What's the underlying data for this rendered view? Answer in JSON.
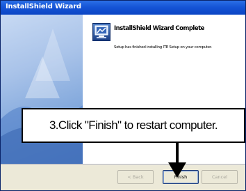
{
  "window": {
    "title": "InstallShield Wizard"
  },
  "dialog": {
    "heading": "InstallShield Wizard Complete",
    "message": "Setup has finished installing ITE Setup on your computer."
  },
  "buttons": {
    "back": "< Back",
    "finish": "Finish",
    "cancel": "Cancel"
  },
  "callout": {
    "text": "3.Click \"Finish\" to restart computer."
  },
  "colors": {
    "titlebar": "#1654d6",
    "dialog_bg": "#ece9d8",
    "side_panel": "#a9c3e9",
    "callout_border": "#000000"
  },
  "icons": {
    "wizard": "wizard-computer-icon",
    "pointer": "down-arrow-icon"
  }
}
